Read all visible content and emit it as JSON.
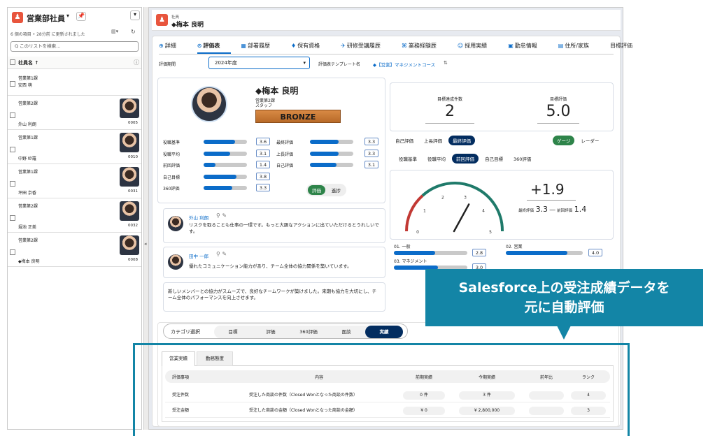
{
  "left_panel": {
    "title": "営業部社員",
    "subtitle": "6 個の項目 • 28分前 に更新されました",
    "search_placeholder": "Q このリストを検索...",
    "column_header": "社員名 ↑",
    "items": [
      {
        "dept": "営業第1課",
        "name": "安西 萌"
      },
      {
        "dept": "営業第2課",
        "name": "外山 利朗",
        "code": "0005"
      },
      {
        "dept": "営業第1課",
        "name": "中野 紗羅",
        "code": "0010"
      },
      {
        "dept": "営業第1課",
        "name": "坪田 京香",
        "code": "0031"
      },
      {
        "dept": "営業第2課",
        "name": "堀池 正美",
        "code": "0032"
      },
      {
        "dept": "営業第2課",
        "name": "◆梅本 良明",
        "code": "0008"
      }
    ]
  },
  "header": {
    "label": "社員",
    "title": "◆梅本 良明"
  },
  "tabs": [
    "詳細",
    "評価表",
    "部署履歴",
    "保有資格",
    "研修受講履歴",
    "業務経験歴",
    "採用実績",
    "勤怠情報",
    "住所/家族",
    "目標評価"
  ],
  "filter": {
    "period_label": "評価期間",
    "period_value": "2024年度",
    "template_label": "評価表テンプレート名",
    "template_value": "◆【営業】マネジメントコース"
  },
  "profile": {
    "name": "◆梅本 良明",
    "dept": "営業第2課",
    "role": "スタッフ",
    "rank": "BRONZE"
  },
  "score_rows": [
    {
      "label": "役職基準",
      "value": "3.6",
      "fill": 0.72
    },
    {
      "label": "役職平均",
      "value": "3.1",
      "fill": 0.62
    },
    {
      "label": "前回評価",
      "value": "1.4",
      "fill": 0.28
    },
    {
      "label": "自己目標",
      "value": "3.8",
      "fill": 0.76
    },
    {
      "label": "360評価",
      "value": "3.3",
      "fill": 0.66
    }
  ],
  "score_rows_right": [
    {
      "label": "最終評価",
      "value": "3.3",
      "fill": 0.66
    },
    {
      "label": "上長評価",
      "value": "3.3",
      "fill": 0.66
    },
    {
      "label": "自己評価",
      "value": "3.1",
      "fill": 0.62
    }
  ],
  "eval_toggle": [
    "評価",
    "進捗"
  ],
  "comments": [
    {
      "name": "外山 利朗",
      "text": "リスクを取ることも仕事の一環です。もっと大胆なアクションに出ていただけるとうれしいです。"
    },
    {
      "name": "田中 一郎",
      "text": "優れたコミュニケーション能力があり、チーム全体の協力関係を築いています。"
    }
  ],
  "summary_text": "新しいメンバーとの協力がスムーズで、良好なチームワークが築けました。来期も協力を大切にし、チーム全体のパフォーマンスを向上させます。",
  "stats": {
    "achieved_label": "目標達成件数",
    "achieved_value": "2",
    "eval_label": "目標評価",
    "eval_value": "5.0"
  },
  "seg_row1": [
    "自己評価",
    "上長評価",
    "最終評価"
  ],
  "seg_view": [
    "ゲージ",
    "レーダー"
  ],
  "seg_row2": [
    "役職基準",
    "役職平均",
    "前回評価",
    "自己目標",
    "360評価"
  ],
  "gauge": {
    "value": 3.3,
    "diff": "+1.9",
    "final_label": "最終評価",
    "final_value": "3.3",
    "dash": "―",
    "prev_label": "前回評価",
    "prev_value": "1.4",
    "ticks": [
      "0",
      "1",
      "2",
      "3",
      "4",
      "5"
    ]
  },
  "categories_scores": [
    {
      "label": "01. 一般",
      "value": "2.8",
      "fill": 0.56
    },
    {
      "label": "02. 営業",
      "value": "4.0",
      "fill": 0.8
    },
    {
      "label": "03. マネジメント",
      "value": "3.0",
      "fill": 0.6
    }
  ],
  "callout": {
    "line1": "Salesforce上の受注成績データを",
    "line2": "元に自動評価"
  },
  "category_select": {
    "label": "カテゴリ選択",
    "options": [
      "目標",
      "評価",
      "360評価",
      "面談",
      "実績"
    ]
  },
  "perf_tabs": [
    "営業実績",
    "勤務態度"
  ],
  "table": {
    "headers": [
      "評価事項",
      "内容",
      "前期実績",
      "今期実績",
      "前年比",
      "ランク"
    ],
    "rows": [
      [
        "受注件数",
        "受注した商談の件数（Closed Wonとなった商談の件数）",
        "0 件",
        "3 件",
        "",
        "4"
      ],
      [
        "受注金額",
        "受注した商談の金額（Closed Wonとなった商談の金額）",
        "¥ 0",
        "¥ 2,800,000",
        "",
        "3"
      ]
    ]
  },
  "colors": {
    "accent": "#0b6cc9",
    "navy": "#032d60",
    "teal": "#1385a6",
    "green": "#2e844a",
    "gauge_red": "#c23934",
    "gauge_teal": "#1f7a6a"
  }
}
